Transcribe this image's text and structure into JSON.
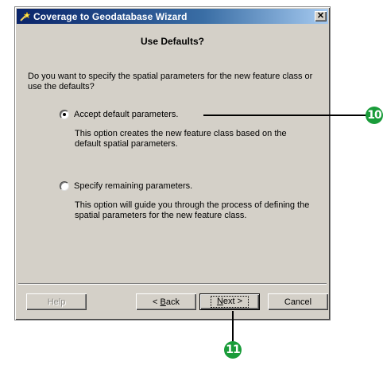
{
  "window": {
    "title": "Coverage to Geodatabase Wizard",
    "close_symbol": "✕"
  },
  "page": {
    "heading": "Use Defaults?",
    "question": "Do you want to specify the spatial parameters for the new feature class or use the defaults?"
  },
  "options": [
    {
      "label": "Accept default parameters.",
      "checked": true,
      "description": "This option creates the new feature class based on the default spatial parameters."
    },
    {
      "label": "Specify remaining parameters.",
      "checked": false,
      "description": "This option will guide you through the process of defining the spatial parameters for the new feature class."
    }
  ],
  "buttons": {
    "help": "Help",
    "back_prefix": "< ",
    "back_mnemonic": "B",
    "back_rest": "ack",
    "next_mnemonic": "N",
    "next_rest": "ext >",
    "cancel": "Cancel"
  },
  "callouts": {
    "accept_marker": "10",
    "next_marker": "11",
    "marker_color": "#1a9c3a"
  },
  "icons": {
    "app": "wizard-wand-icon",
    "close": "close-icon",
    "radio_checked": "radio-checked-icon",
    "radio_unchecked": "radio-unchecked-icon"
  }
}
